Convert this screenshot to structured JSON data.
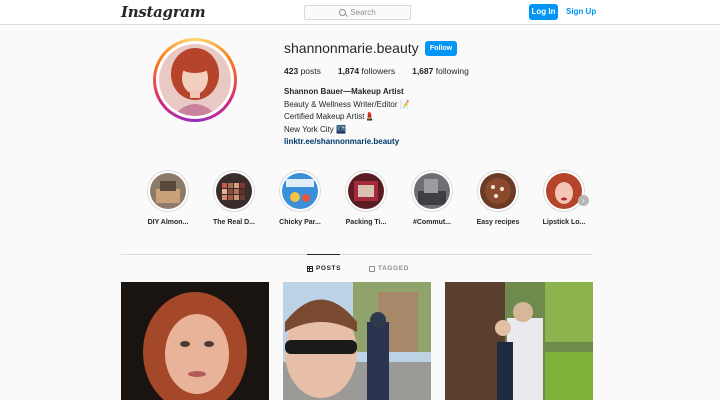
{
  "topbar": {
    "logo": "Instagram",
    "search_placeholder": "Search",
    "login_label": "Log In",
    "signup_label": "Sign Up"
  },
  "profile": {
    "username": "shannonmarie.beauty",
    "follow_label": "Follow",
    "posts_count": "423",
    "posts_label": "posts",
    "followers_count": "1,874",
    "followers_label": "followers",
    "following_count": "1,687",
    "following_label": "following",
    "bio_name": "Shannon Bauer—Makeup Artist",
    "bio_line1": "Beauty & Wellness Writer/Editor 📝",
    "bio_line2": "Certified Makeup Artist💄",
    "bio_line3": "New York City 🌃",
    "bio_link": "linktr.ee/shannonmarie.beauty"
  },
  "highlights": [
    {
      "label": "DIY Almon..."
    },
    {
      "label": "The Real D..."
    },
    {
      "label": "Chicky Par..."
    },
    {
      "label": "Packing Ti..."
    },
    {
      "label": "#Commut..."
    },
    {
      "label": "Easy recipes"
    },
    {
      "label": "Lipstick Lo..."
    }
  ],
  "tabs": {
    "posts": "POSTS",
    "tagged": "TAGGED"
  },
  "colors": {
    "accent": "#0095f6",
    "link": "#00376b",
    "text": "#262626",
    "muted": "#8e8e8e",
    "border": "#dbdbdb"
  },
  "icons": [
    "search-icon",
    "grid-icon",
    "tag-icon",
    "chevron-right-icon"
  ]
}
